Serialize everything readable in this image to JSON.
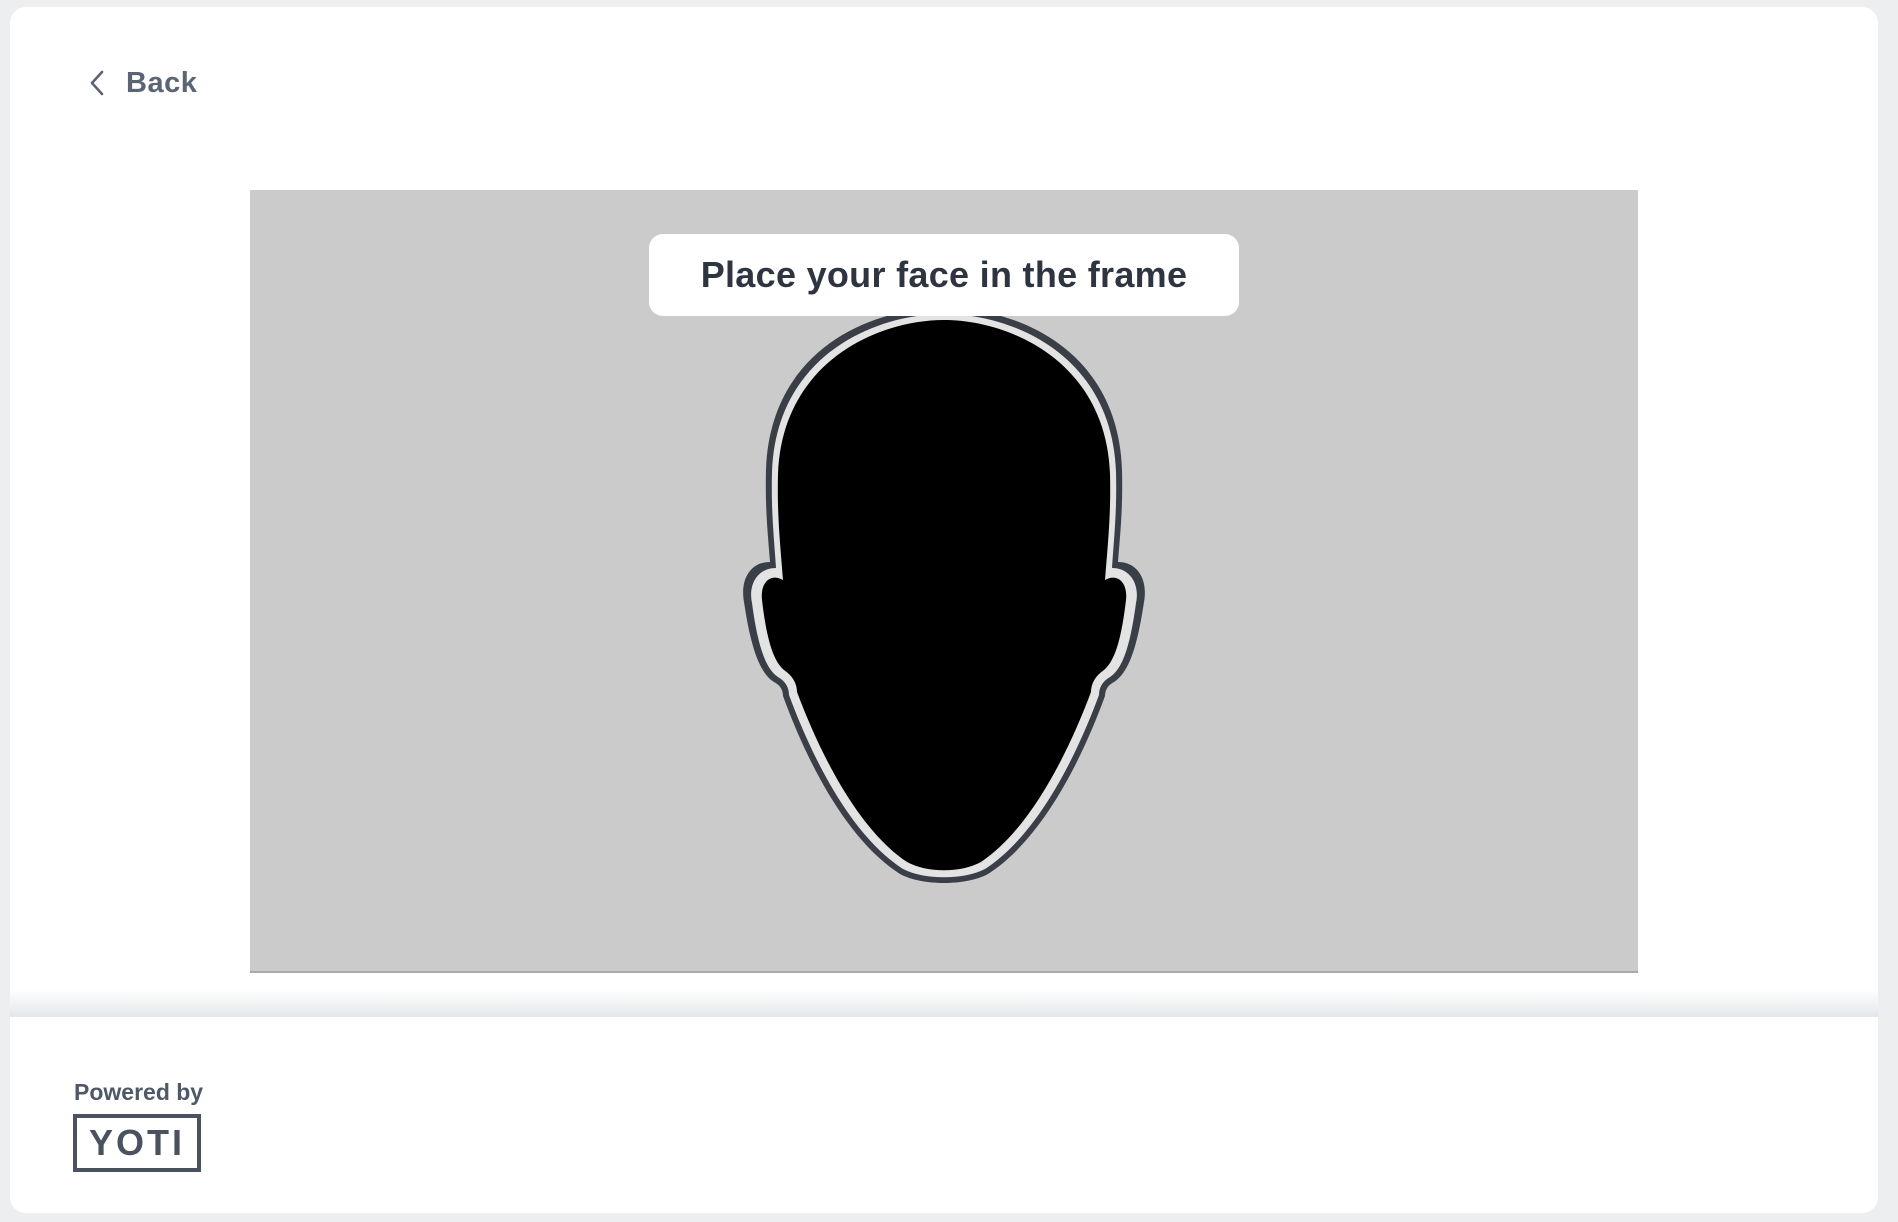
{
  "navigation": {
    "back_label": "Back",
    "back_icon": "chevron-left-icon"
  },
  "camera": {
    "instruction": "Place your face in the frame",
    "overlay_icon": "face-outline-icon"
  },
  "footer": {
    "powered_by": "Powered by",
    "logo_text": "YOTI"
  },
  "colors": {
    "background": "#eceef0",
    "card": "#ffffff",
    "camera_bg": "#cbcbcb",
    "text_dark": "#2f3540",
    "text_muted": "#5a6473",
    "face_fill": "#000000",
    "face_outline": "#3a3f47"
  }
}
